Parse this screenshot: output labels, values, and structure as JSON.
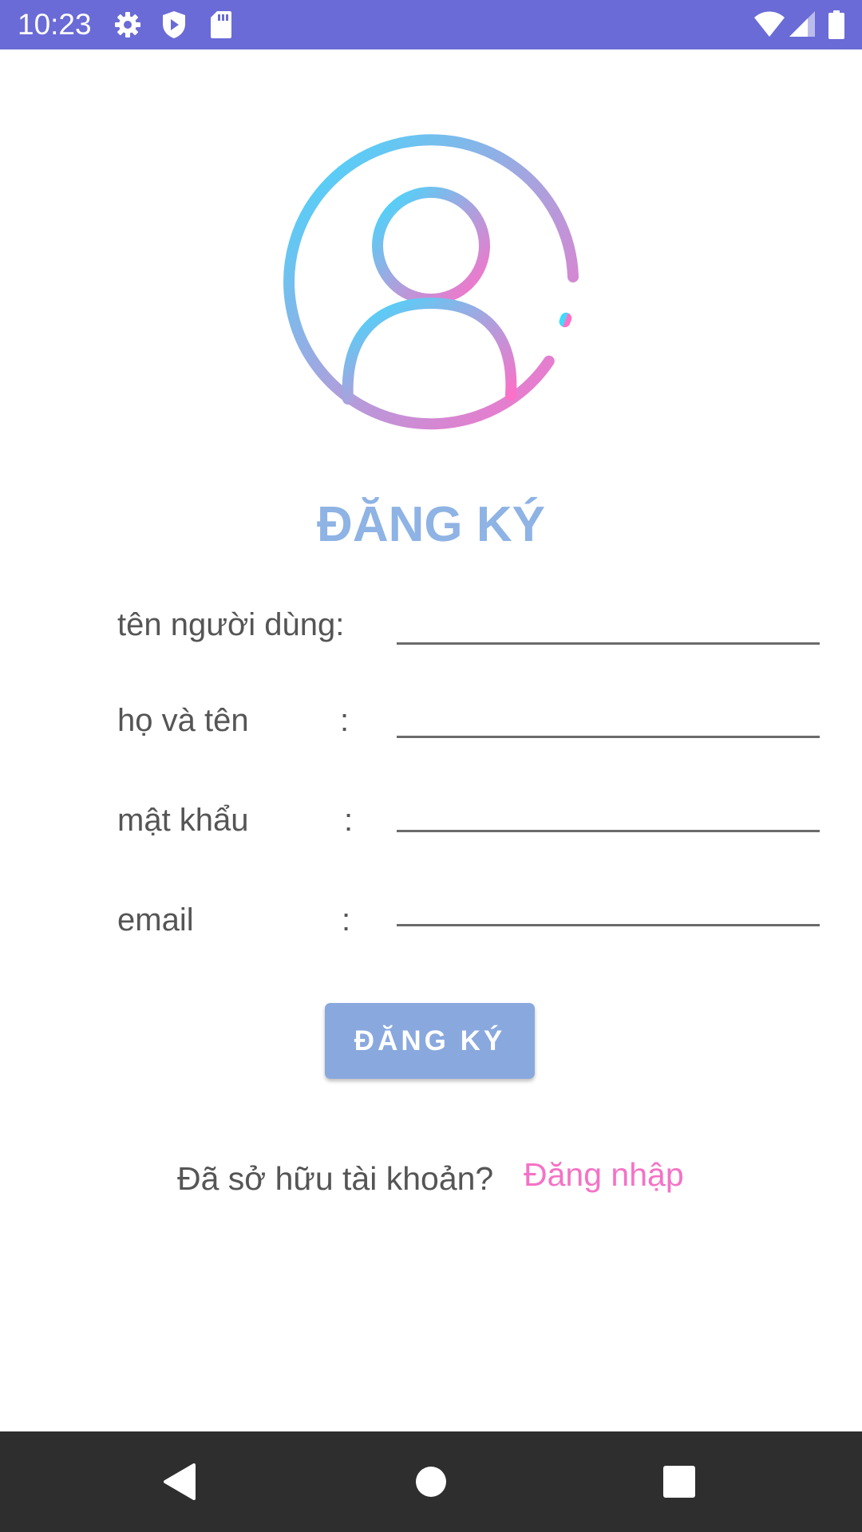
{
  "status_bar": {
    "time": "10:23",
    "background": "#6a6bd6",
    "left_icons": [
      "gear-icon",
      "shield-play-icon",
      "sd-card-icon"
    ],
    "right_icons": [
      "wifi-icon",
      "cellular-signal-icon",
      "battery-icon"
    ]
  },
  "avatar": {
    "icon": "user-circle-icon",
    "gradient_start": "#3ddcff",
    "gradient_end": "#ff6ec7"
  },
  "form": {
    "title": "ĐĂNG KÝ",
    "fields": [
      {
        "label": "tên người dùng:",
        "colon": "",
        "value": ""
      },
      {
        "label": "họ và tên",
        "colon": ":",
        "value": ""
      },
      {
        "label": "mật khẩu",
        "colon": ":",
        "value": ""
      },
      {
        "label": "email",
        "colon": ":",
        "value": ""
      }
    ],
    "submit_label": "ĐĂNG KÝ",
    "title_color": "#8eb3e4",
    "button_color": "#89a8de"
  },
  "footer": {
    "question": "Đã sở hữu tài khoản?",
    "login_link": "Đăng nhập",
    "link_color": "#f472c6"
  },
  "nav_bar": {
    "buttons": [
      "back-triangle-icon",
      "home-circle-icon",
      "recents-square-icon"
    ]
  }
}
